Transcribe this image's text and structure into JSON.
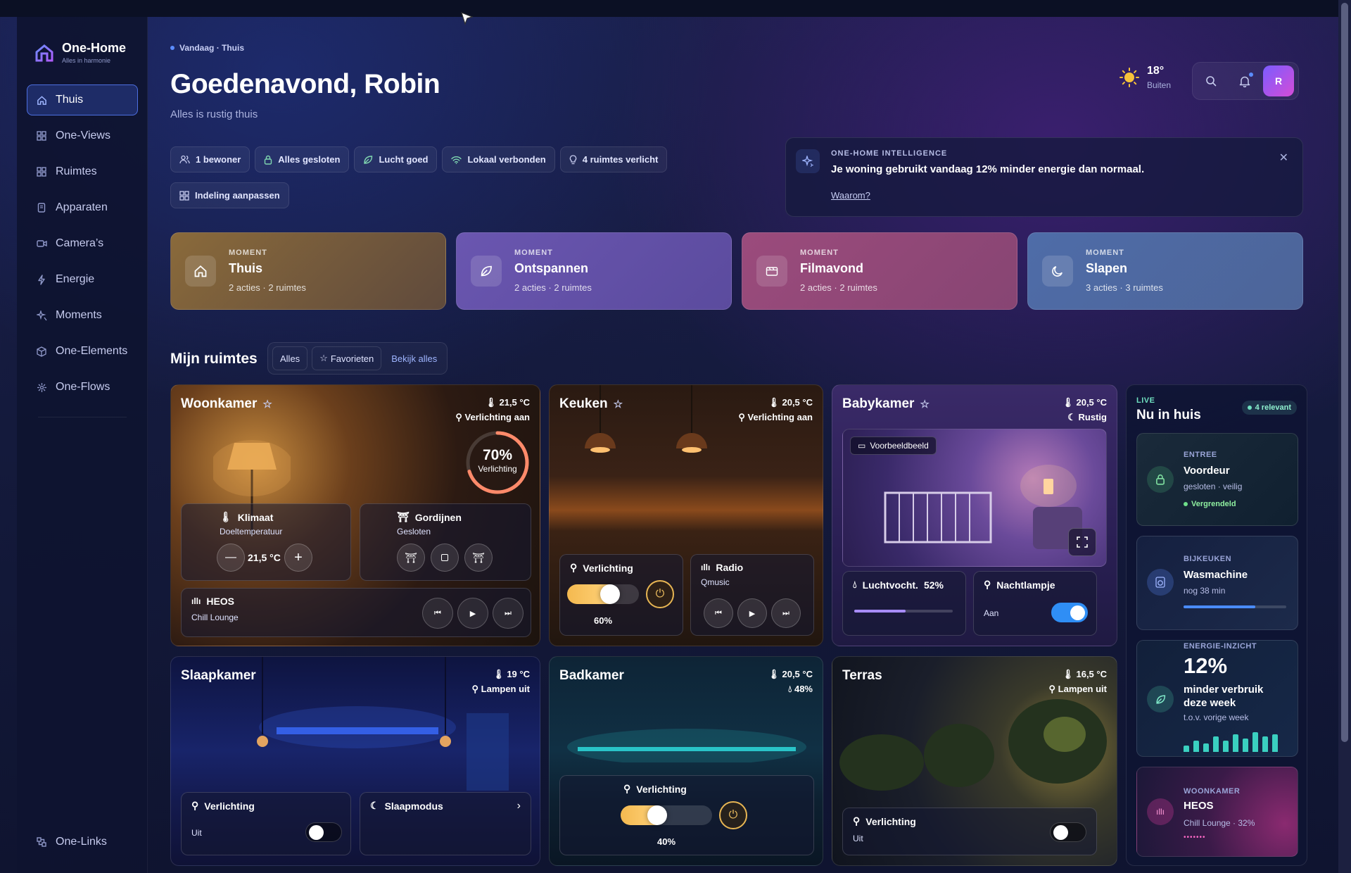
{
  "app": {
    "name": "One-Home",
    "tagline": "Alles in harmonie"
  },
  "nav": [
    {
      "label": "Thuis",
      "icon": "home-icon",
      "active": true
    },
    {
      "label": "One-Views",
      "icon": "grid-icon"
    },
    {
      "label": "Ruimtes",
      "icon": "grid-icon"
    },
    {
      "label": "Apparaten",
      "icon": "device-icon"
    },
    {
      "label": "Camera’s",
      "icon": "camera-icon"
    },
    {
      "label": "Energie",
      "icon": "bolt-icon"
    },
    {
      "label": "Moments",
      "icon": "sparkle-icon"
    },
    {
      "label": "One-Elements",
      "icon": "cube-icon"
    },
    {
      "label": "One-Flows",
      "icon": "flow-icon"
    }
  ],
  "nav_bottom": {
    "label": "One-Links",
    "icon": "link-icon"
  },
  "header": {
    "crumb": "Vandaag · Thuis",
    "greeting": "Goedenavond, Robin",
    "subtitle": "Alles is rustig thuis",
    "weather": {
      "temp": "18°",
      "label": "Buiten",
      "icon": "sun-icon"
    },
    "avatar": "R"
  },
  "chips": [
    {
      "label": "1 bewoner",
      "icon": "users-icon"
    },
    {
      "label": "Alles gesloten",
      "icon": "lock-icon"
    },
    {
      "label": "Lucht goed",
      "icon": "leaf-icon"
    },
    {
      "label": "Lokaal verbonden",
      "icon": "wifi-icon"
    },
    {
      "label": "4 ruimtes verlicht",
      "icon": "bulb-icon"
    },
    {
      "label": "Indeling aanpassen",
      "icon": "grid-icon"
    }
  ],
  "intelligence": {
    "label": "ONE-HOME INTELLIGENCE",
    "text": "Je woning gebruikt vandaag 12% minder energie dan normaal.",
    "link": "Waarom?"
  },
  "moments": [
    {
      "label": "MOMENT",
      "title": "Thuis",
      "sub": "2 acties · 2 ruimtes",
      "icon": "home-icon"
    },
    {
      "label": "MOMENT",
      "title": "Ontspannen",
      "sub": "2 acties · 2 ruimtes",
      "icon": "leaf-icon"
    },
    {
      "label": "MOMENT",
      "title": "Filmavond",
      "sub": "2 acties · 2 ruimtes",
      "icon": "film-icon"
    },
    {
      "label": "MOMENT",
      "title": "Slapen",
      "sub": "3 acties · 3 ruimtes",
      "icon": "moon-icon"
    }
  ],
  "ruimtes": {
    "title": "Mijn ruimtes",
    "filter_all": "Alles",
    "filter_fav": "Favorieten",
    "see_all": "Bekijk alles"
  },
  "rooms": {
    "woonkamer": {
      "name": "Woonkamer",
      "temp": "21,5 °C",
      "light": "Verlichting aan",
      "dial_value": "70%",
      "dial_label": "Verlichting",
      "dial_level": 0.7,
      "klimaat": {
        "title": "Klimaat",
        "sub": "Doeltemperatuur",
        "value": "21,5 °C"
      },
      "gordijnen": {
        "title": "Gordijnen",
        "sub": "Gesloten"
      },
      "heos": {
        "title": "HEOS",
        "sub": "Chill Lounge"
      }
    },
    "keuken": {
      "name": "Keuken",
      "temp": "20,5 °C",
      "light": "Verlichting aan",
      "verlichting": {
        "title": "Verlichting",
        "pct": "60%",
        "level": 0.6
      },
      "radio": {
        "title": "Radio",
        "sub": "Qmusic"
      }
    },
    "babykamer": {
      "name": "Babykamer",
      "temp": "20,5 °C",
      "status": "Rustig",
      "preview": "Voorbeeldbeeld",
      "humidity": {
        "title": "Luchtvocht.",
        "value": "52%",
        "level": 0.52
      },
      "nachtlampje": {
        "title": "Nachtlampje",
        "state": "Aan"
      }
    },
    "slaapkamer": {
      "name": "Slaapkamer",
      "temp": "19 °C",
      "light": "Lampen uit",
      "verlichting": {
        "title": "Verlichting",
        "state": "Uit"
      },
      "slaapmodus": {
        "title": "Slaapmodus"
      }
    },
    "badkamer": {
      "name": "Badkamer",
      "temp": "20,5 °C",
      "humidity": "48%",
      "verlichting": {
        "title": "Verlichting",
        "pct": "40%",
        "level": 0.4
      }
    },
    "terras": {
      "name": "Terras",
      "temp": "16,5 °C",
      "light": "Lampen uit",
      "verlichting": {
        "title": "Verlichting",
        "state": "Uit"
      }
    }
  },
  "live": {
    "label": "LIVE",
    "title": "Nu in huis",
    "badge": "4 relevant",
    "cards": [
      {
        "cat": "ENTREE",
        "title": "Voordeur",
        "sub": "gesloten · veilig",
        "status": "Vergrendeld",
        "icon": "lock-icon"
      },
      {
        "cat": "BIJKEUKEN",
        "title": "Wasmachine",
        "sub": "nog 38 min",
        "icon": "washer-icon",
        "progress": 0.7
      },
      {
        "cat": "ENERGIE-INZICHT",
        "value": "12%",
        "title": "minder verbruik deze week",
        "sub": "t.o.v. vorige week",
        "icon": "leaf-icon",
        "bars": [
          3,
          5,
          4,
          7,
          5,
          8,
          6,
          9,
          7,
          8
        ]
      },
      {
        "cat": "WOONKAMER",
        "title": "HEOS",
        "sub": "Chill Lounge · 32%",
        "icon": "audio-icon"
      }
    ]
  },
  "colors": {
    "accent": "#5b8cff",
    "green": "#6fe0c0",
    "amber": "#f4b94f"
  }
}
